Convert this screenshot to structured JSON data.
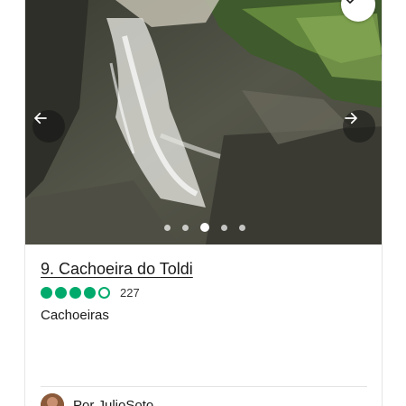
{
  "attraction": {
    "title": "9. Cachoeira do Toldi",
    "rating": 4,
    "rating_max": 5,
    "review_count": "227",
    "category": "Cachoeiras",
    "author": "Por JulioSoto"
  },
  "carousel": {
    "total": 5,
    "active_index": 2
  },
  "icons": {
    "save": "heart-icon",
    "prev": "arrow-left-icon",
    "next": "arrow-right-icon"
  },
  "colors": {
    "rating_green": "#00aa6c"
  }
}
